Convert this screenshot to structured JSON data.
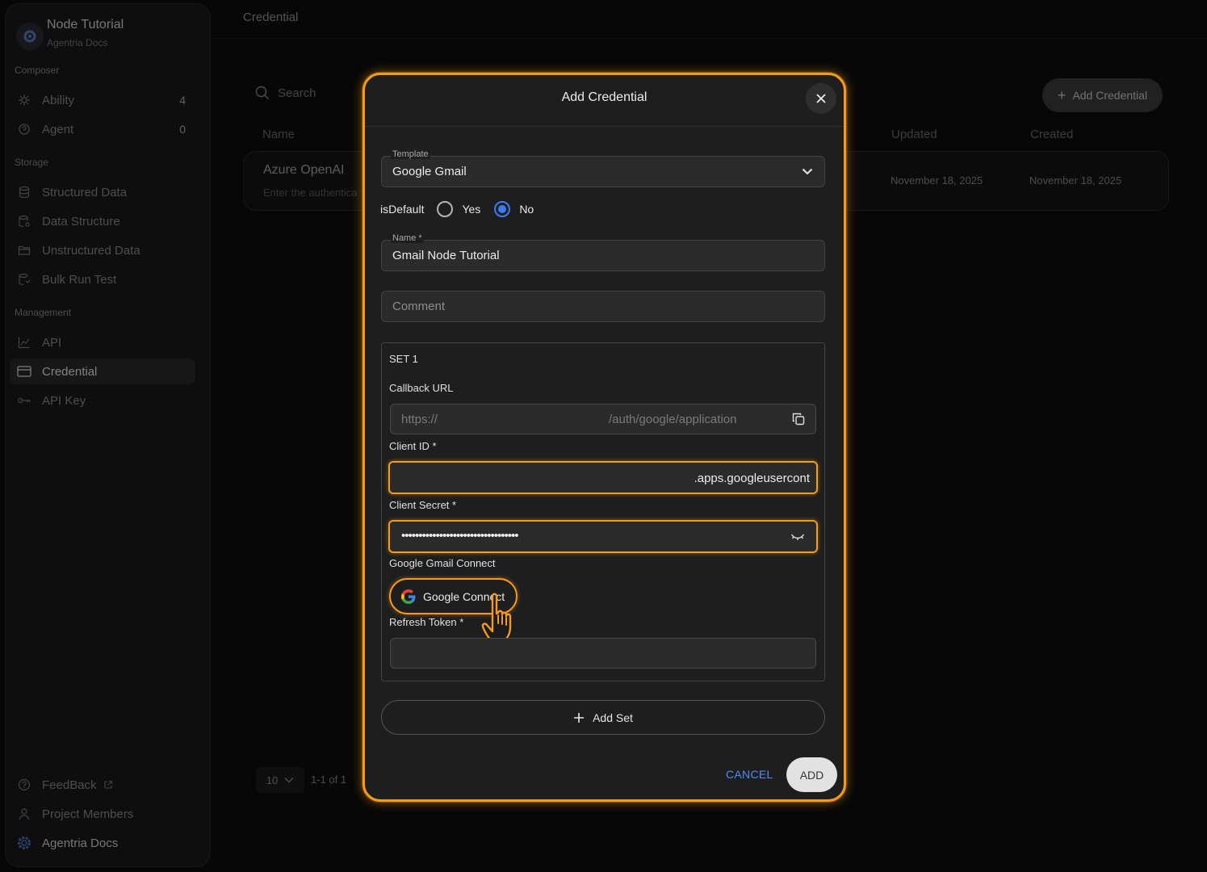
{
  "brand": {
    "title": "Node Tutorial",
    "subtitle": "Agentria Docs"
  },
  "sidebar": {
    "sections": [
      "Composer",
      "Storage",
      "Management"
    ],
    "items": [
      {
        "label": "Ability",
        "count": "4",
        "icon": "ability-icon"
      },
      {
        "label": "Agent",
        "count": "0",
        "icon": "agent-icon"
      },
      {
        "label": "Structured Data",
        "icon": "database-icon"
      },
      {
        "label": "Data Structure",
        "icon": "data-structure-icon"
      },
      {
        "label": "Unstructured Data",
        "icon": "folder-icon"
      },
      {
        "label": "Bulk Run Test",
        "icon": "bulk-test-icon"
      },
      {
        "label": "API",
        "icon": "chart-line-icon"
      },
      {
        "label": "Credential",
        "icon": "credential-card-icon"
      },
      {
        "label": "API Key",
        "icon": "key-icon"
      }
    ],
    "footer": [
      {
        "label": "FeedBack",
        "icon": "help-circle-icon"
      },
      {
        "label": "Project Members",
        "icon": "user-icon"
      },
      {
        "label": "Agentria Docs",
        "icon": "gear-icon"
      }
    ]
  },
  "page": {
    "title": "Credential",
    "search_placeholder": "Search",
    "add_button": "Add Credential",
    "columns": {
      "name": "Name",
      "updated": "Updated",
      "created": "Created"
    },
    "row": {
      "title": "Azure OpenAI",
      "desc": "Enter the authentica",
      "updated": "November 18, 2025",
      "created": "November 18, 2025"
    },
    "pager": {
      "size": "10",
      "info": "1-1 of 1"
    }
  },
  "modal": {
    "title": "Add Credential",
    "template_label": "Template",
    "template_value": "Google Gmail",
    "isdefault_label": "isDefault",
    "yes_label": "Yes",
    "no_label": "No",
    "isdefault_selected": "No",
    "name_label": "Name *",
    "name_value": "Gmail Node Tutorial",
    "comment_placeholder": "Comment",
    "set_title": "SET 1",
    "callback_label": "Callback URL",
    "callback_prefix": "https://",
    "callback_suffix": "/auth/google/application",
    "client_id_label": "Client ID *",
    "client_id_value": ".apps.googleusercont",
    "client_secret_label": "Client Secret *",
    "client_secret_value": "••••••••••••••••••••••••••••••••••",
    "gmail_connect_label": "Google Gmail Connect",
    "google_connect_button": "Google Connect",
    "refresh_token_label": "Refresh Token *",
    "add_set": "Add Set",
    "cancel": "CANCEL",
    "add": "ADD"
  },
  "colors": {
    "highlight": "#f59a1b",
    "accent_blue": "#3d7cf0"
  }
}
